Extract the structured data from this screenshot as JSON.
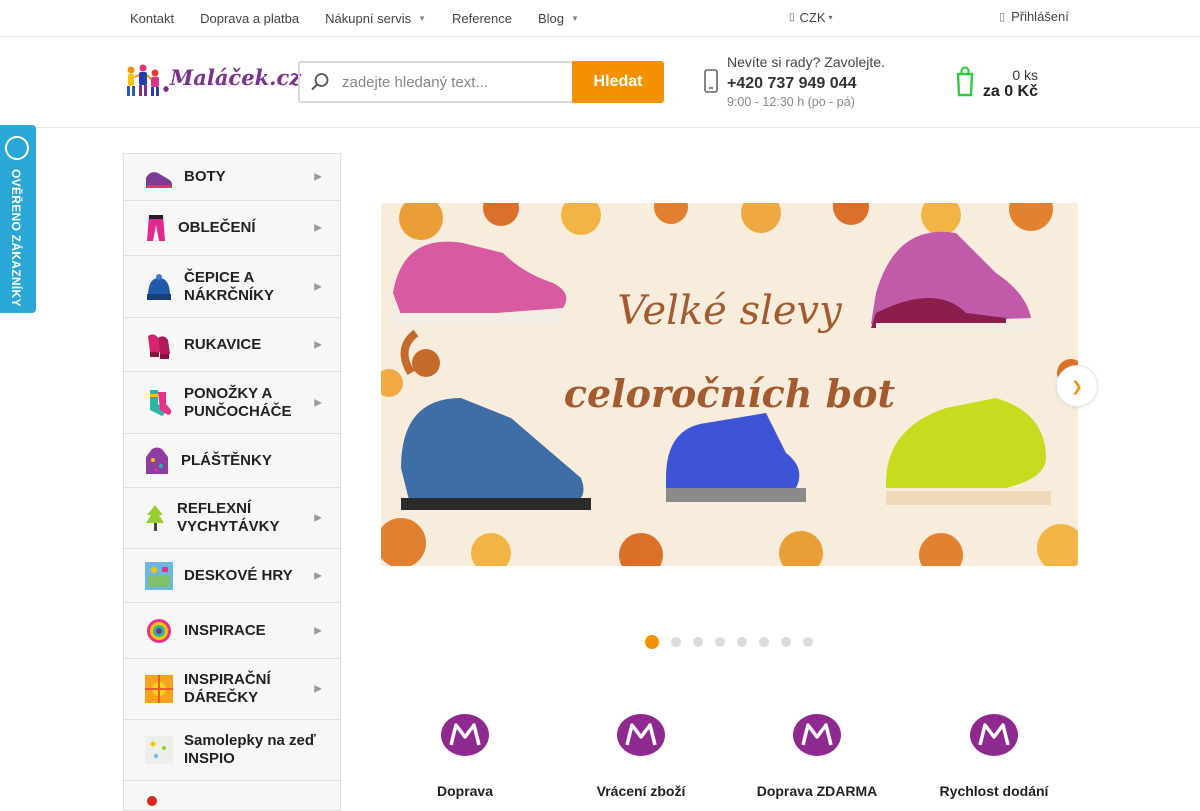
{
  "topnav": {
    "items": [
      {
        "label": "Kontakt",
        "has_dropdown": false
      },
      {
        "label": "Doprava a platba",
        "has_dropdown": false
      },
      {
        "label": "Nákupní servis",
        "has_dropdown": true
      },
      {
        "label": "Reference",
        "has_dropdown": false
      },
      {
        "label": "Blog",
        "has_dropdown": true
      }
    ],
    "currency": "CZK",
    "login": "Přihlášení"
  },
  "header": {
    "logo_text": "Maláček.cz",
    "search": {
      "placeholder": "zadejte hledaný text...",
      "button": "Hledat"
    },
    "contact": {
      "line1": "Nevíte si rady? Zavolejte.",
      "phone": "+420 737 949 044",
      "hours": "9:00 - 12:30 h (po - pá)"
    },
    "cart": {
      "quantity": "0 ks",
      "total": "za 0 Kč"
    }
  },
  "badge": {
    "text": "OVĚŘENO ZÁKAZNÍKY"
  },
  "sidebar": {
    "items": [
      {
        "label": "BOTY",
        "icon": "shoe-icon",
        "has_submenu": true
      },
      {
        "label": "OBLEČENÍ",
        "icon": "pants-icon",
        "has_submenu": true
      },
      {
        "label": "ČEPICE A NÁKRČNÍKY",
        "icon": "hat-icon",
        "has_submenu": true
      },
      {
        "label": "RUKAVICE",
        "icon": "gloves-icon",
        "has_submenu": true
      },
      {
        "label": "PONOŽKY A PUNČOCHÁČE",
        "icon": "socks-icon",
        "has_submenu": true
      },
      {
        "label": "PLÁŠTĚNKY",
        "icon": "raincoat-icon",
        "has_submenu": false
      },
      {
        "label": "REFLEXNÍ VYCHYTÁVKY",
        "icon": "reflective-icon",
        "has_submenu": true
      },
      {
        "label": "DESKOVÉ HRY",
        "icon": "board-game-icon",
        "has_submenu": true
      },
      {
        "label": "INSPIRACE",
        "icon": "inspiration-icon",
        "has_submenu": true
      },
      {
        "label": "INSPIRAČNÍ DÁREČKY",
        "icon": "gift-icon",
        "has_submenu": true
      },
      {
        "label": "Samolepky na zeď INSPIO",
        "icon": "sticker-icon",
        "has_submenu": false
      }
    ]
  },
  "banner": {
    "headline1": "Velké slevy",
    "headline2": "celoročních bot",
    "slides": 8,
    "active_slide": 1
  },
  "features": [
    {
      "title": "Doprava"
    },
    {
      "title": "Vrácení zboží"
    },
    {
      "title": "Doprava ZDARMA"
    },
    {
      "title": "Rychlost dodání"
    }
  ],
  "colors": {
    "accent": "#f39100",
    "brand": "#7b2f8e",
    "badge": "#2aa7d6",
    "cart": "#2ecc40"
  }
}
